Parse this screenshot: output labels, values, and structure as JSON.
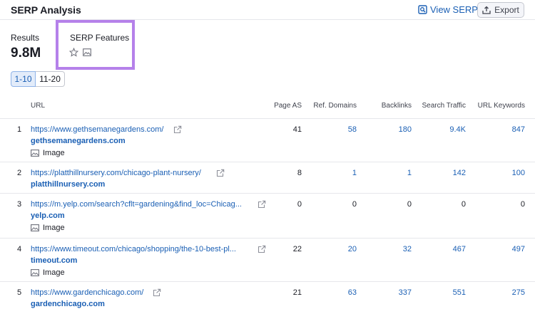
{
  "header": {
    "title": "SERP Analysis",
    "view_serp_label": "View SERP",
    "export_label": "Export"
  },
  "summary": {
    "results_label": "Results",
    "results_value": "9.8M",
    "features_label": "SERP Features",
    "feature_icons": [
      "star-icon",
      "image-icon"
    ],
    "highlight_color": "#b581ea"
  },
  "pagination": {
    "pages": [
      "1-10",
      "11-20"
    ],
    "selected": "1-10"
  },
  "table": {
    "columns": {
      "url": "URL",
      "page_as": "Page AS",
      "ref_domains": "Ref. Domains",
      "backlinks": "Backlinks",
      "search_traffic": "Search Traffic",
      "url_keywords": "URL Keywords"
    },
    "image_tag": "Image",
    "rows": [
      {
        "rank": "1",
        "url": "https://www.gethsemanegardens.com/",
        "domain": "gethsemanegardens.com",
        "has_image": true,
        "page_as": "41",
        "ref_domains": "58",
        "backlinks": "180",
        "search_traffic": "9.4K",
        "url_keywords": "847"
      },
      {
        "rank": "2",
        "url": "https://platthillnursery.com/chicago-plant-nursery/",
        "domain": "platthillnursery.com",
        "has_image": false,
        "page_as": "8",
        "ref_domains": "1",
        "backlinks": "1",
        "search_traffic": "142",
        "url_keywords": "100"
      },
      {
        "rank": "3",
        "url": "https://m.yelp.com/search?cflt=gardening&find_loc=Chicag...",
        "domain": "yelp.com",
        "has_image": true,
        "page_as": "0",
        "ref_domains": "0",
        "backlinks": "0",
        "search_traffic": "0",
        "url_keywords": "0"
      },
      {
        "rank": "4",
        "url": "https://www.timeout.com/chicago/shopping/the-10-best-pl...",
        "domain": "timeout.com",
        "has_image": true,
        "page_as": "22",
        "ref_domains": "20",
        "backlinks": "32",
        "search_traffic": "467",
        "url_keywords": "497"
      },
      {
        "rank": "5",
        "url": "https://www.gardenchicago.com/",
        "domain": "gardenchicago.com",
        "has_image": false,
        "page_as": "21",
        "ref_domains": "63",
        "backlinks": "337",
        "search_traffic": "551",
        "url_keywords": "275"
      }
    ]
  },
  "colors": {
    "link": "#1a5fb4",
    "text": "#191b23",
    "border": "#e6e7eb"
  }
}
